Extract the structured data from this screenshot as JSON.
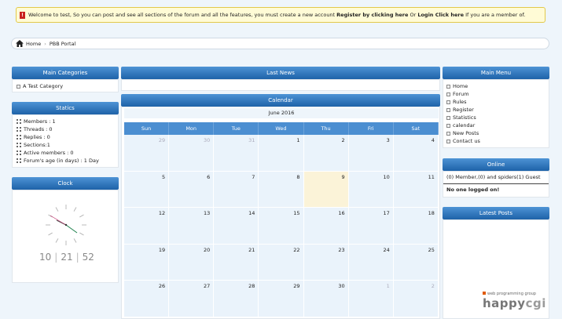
{
  "notice": {
    "pre": "Welcome to test, So you can post and see all sections of the forum and all the features, you must create a new account ",
    "register": "Register by clicking here",
    "or": " Or ",
    "login": "Login Click here",
    "post": " If you are a member of."
  },
  "breadcrumb": {
    "home": "Home",
    "portal": "PBB Portal"
  },
  "main_categories": {
    "title": "Main Categories",
    "items": [
      "A Test Category"
    ]
  },
  "statics": {
    "title": "Statics",
    "items": [
      "Members : 1",
      "Threads : 0",
      "Replies : 0",
      "Sections:1",
      "Active members : 0",
      "Forum's age (in days) : 1 Day"
    ]
  },
  "clock": {
    "title": "Clock",
    "hours": "10",
    "minutes": "21",
    "seconds": "52",
    "sep": "|"
  },
  "last_news": {
    "title": "Last News"
  },
  "calendar": {
    "title": "Calendar",
    "month": "June 2016",
    "weekdays": [
      "Sun",
      "Mon",
      "Tue",
      "Wed",
      "Thu",
      "Fri",
      "Sat"
    ],
    "days": [
      {
        "d": "29",
        "o": true
      },
      {
        "d": "30",
        "o": true
      },
      {
        "d": "31",
        "o": true
      },
      {
        "d": "1"
      },
      {
        "d": "2"
      },
      {
        "d": "3"
      },
      {
        "d": "4"
      },
      {
        "d": "5"
      },
      {
        "d": "6"
      },
      {
        "d": "7"
      },
      {
        "d": "8"
      },
      {
        "d": "9",
        "t": true
      },
      {
        "d": "10"
      },
      {
        "d": "11"
      },
      {
        "d": "12"
      },
      {
        "d": "13"
      },
      {
        "d": "14"
      },
      {
        "d": "15"
      },
      {
        "d": "16"
      },
      {
        "d": "17"
      },
      {
        "d": "18"
      },
      {
        "d": "19"
      },
      {
        "d": "20"
      },
      {
        "d": "21"
      },
      {
        "d": "22"
      },
      {
        "d": "23"
      },
      {
        "d": "24"
      },
      {
        "d": "25"
      },
      {
        "d": "26"
      },
      {
        "d": "27"
      },
      {
        "d": "28"
      },
      {
        "d": "29"
      },
      {
        "d": "30"
      },
      {
        "d": "1",
        "o": true
      },
      {
        "d": "2",
        "o": true
      }
    ]
  },
  "main_menu": {
    "title": "Main Menu",
    "items": [
      "Home",
      "Forum",
      "Rules",
      "Register",
      "Statistics",
      "calendar",
      "New Posts",
      "Contact us"
    ]
  },
  "online": {
    "title": "Online",
    "summary": "(0) Member,(0) and spiders(1) Guest",
    "status": "No one logged on!"
  },
  "latest_posts": {
    "title": "Latest Posts"
  },
  "logo": {
    "tagline": "web programming group",
    "brand_a": "happy",
    "brand_b": "cgi"
  }
}
